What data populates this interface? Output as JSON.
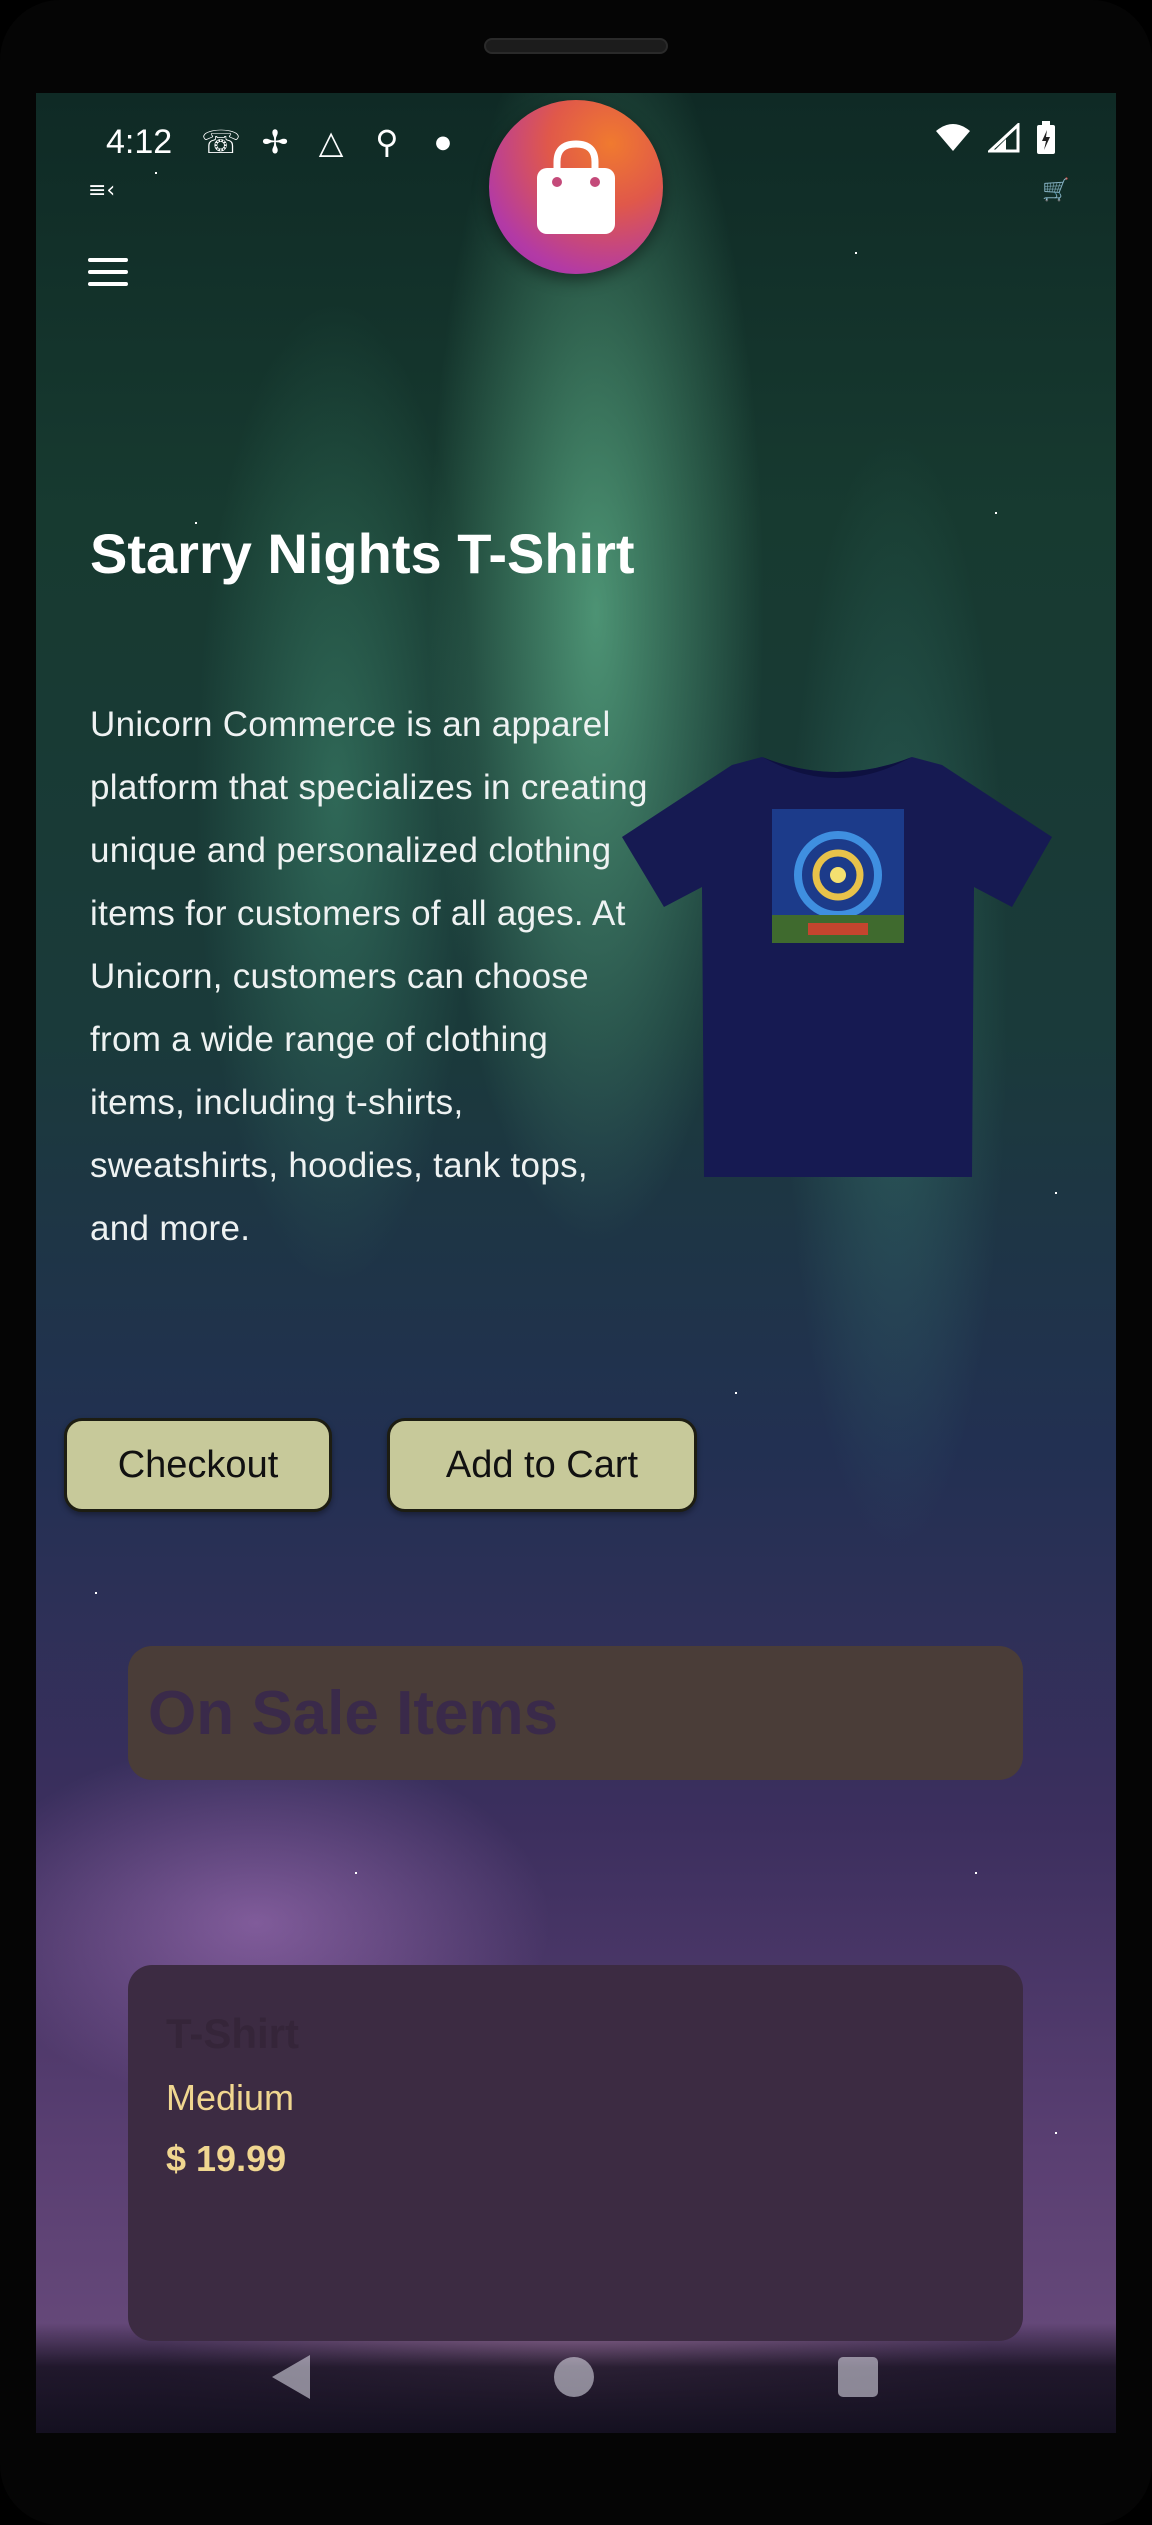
{
  "status_bar": {
    "time": "4:12",
    "left_icons": [
      "phone-missed-icon",
      "fan-icon",
      "drive-icon",
      "keyhole-icon",
      "dot-icon"
    ],
    "right_icons": [
      "wifi-icon",
      "signal-icon",
      "battery-charging-icon"
    ]
  },
  "app": {
    "logo_icon": "shopping-bag-icon",
    "menu_icon": "hamburger-menu-icon",
    "cart_icon": "cart-icon"
  },
  "product": {
    "title": "Starry Nights T-Shirt",
    "description": "Unicorn Commerce is an apparel platform that specializes in creating unique and personalized clothing items for customers of all ages. At Unicorn, customers can choose from a wide range of clothing items, including t-shirts, sweatshirts, hoodies, tank tops, and more.",
    "image_icon": "tshirt-image"
  },
  "actions": {
    "checkout_label": "Checkout",
    "add_to_cart_label": "Add to Cart"
  },
  "sale": {
    "header": "On Sale Items",
    "items": [
      {
        "name": "T-Shirt",
        "size": "Medium",
        "price": "$ 19.99"
      }
    ]
  },
  "nav": {
    "back_icon": "back-triangle-icon",
    "home_icon": "home-circle-icon",
    "recents_icon": "recents-square-icon"
  },
  "colors": {
    "button_bg": "#c7c99a",
    "sale_header_bg": "#4a3d38",
    "sale_card_bg": "#3c2b42",
    "price_text": "#f0d690",
    "logo_gradient_start": "#f07a2f",
    "logo_gradient_end": "#9b2fb0"
  }
}
